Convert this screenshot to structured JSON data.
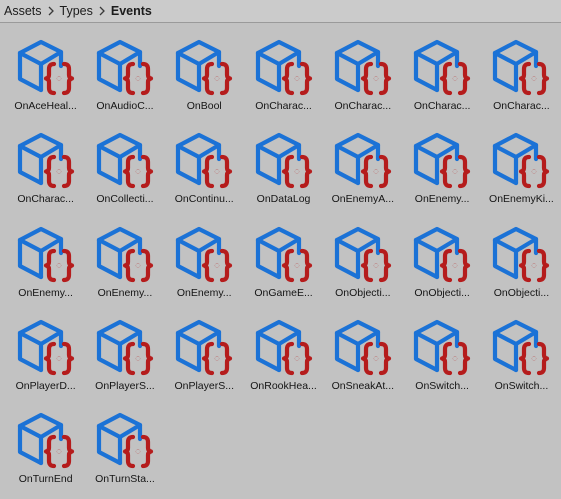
{
  "breadcrumb": {
    "items": [
      "Assets",
      "Types",
      "Events"
    ]
  },
  "colors": {
    "cube": "#1b72d6",
    "braces": "#b51c1c",
    "background": "#c2c2c2"
  },
  "icon_name": "script-event-icon",
  "assets": [
    {
      "label": "OnAceHeal..."
    },
    {
      "label": "OnAudioC..."
    },
    {
      "label": "OnBool"
    },
    {
      "label": "OnCharac..."
    },
    {
      "label": "OnCharac..."
    },
    {
      "label": "OnCharac..."
    },
    {
      "label": "OnCharac..."
    },
    {
      "label": "OnCharac..."
    },
    {
      "label": "OnCollecti..."
    },
    {
      "label": "OnContinu..."
    },
    {
      "label": "OnDataLog"
    },
    {
      "label": "OnEnemyA..."
    },
    {
      "label": "OnEnemy..."
    },
    {
      "label": "OnEnemyKi..."
    },
    {
      "label": "OnEnemy..."
    },
    {
      "label": "OnEnemy..."
    },
    {
      "label": "OnEnemy..."
    },
    {
      "label": "OnGameE..."
    },
    {
      "label": "OnObjecti..."
    },
    {
      "label": "OnObjecti..."
    },
    {
      "label": "OnObjecti..."
    },
    {
      "label": "OnPlayerD..."
    },
    {
      "label": "OnPlayerS..."
    },
    {
      "label": "OnPlayerS..."
    },
    {
      "label": "OnRookHea..."
    },
    {
      "label": "OnSneakAt..."
    },
    {
      "label": "OnSwitch..."
    },
    {
      "label": "OnSwitch..."
    },
    {
      "label": "OnTurnEnd"
    },
    {
      "label": "OnTurnSta..."
    }
  ]
}
